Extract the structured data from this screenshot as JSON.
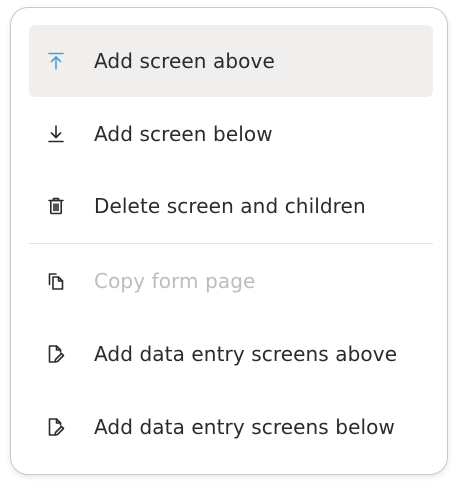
{
  "menu": {
    "items": [
      {
        "label": "Add screen above",
        "icon": "arrow-up-to-line-icon",
        "highlighted": true,
        "disabled": false
      },
      {
        "label": "Add screen below",
        "icon": "arrow-down-to-line-icon",
        "highlighted": false,
        "disabled": false
      },
      {
        "label": "Delete screen and children",
        "icon": "trash-icon",
        "highlighted": false,
        "disabled": false
      },
      {
        "label": "Copy form page",
        "icon": "copy-icon",
        "highlighted": false,
        "disabled": true
      },
      {
        "label": "Add data entry screens above",
        "icon": "file-edit-icon",
        "highlighted": false,
        "disabled": false
      },
      {
        "label": "Add data entry screens below",
        "icon": "file-edit-icon",
        "highlighted": false,
        "disabled": false
      }
    ]
  },
  "colors": {
    "highlight_bg": "#f1efed",
    "accent_icon": "#4a9fd8",
    "text": "#2b2b2b",
    "disabled_text": "#bdbdbd"
  }
}
